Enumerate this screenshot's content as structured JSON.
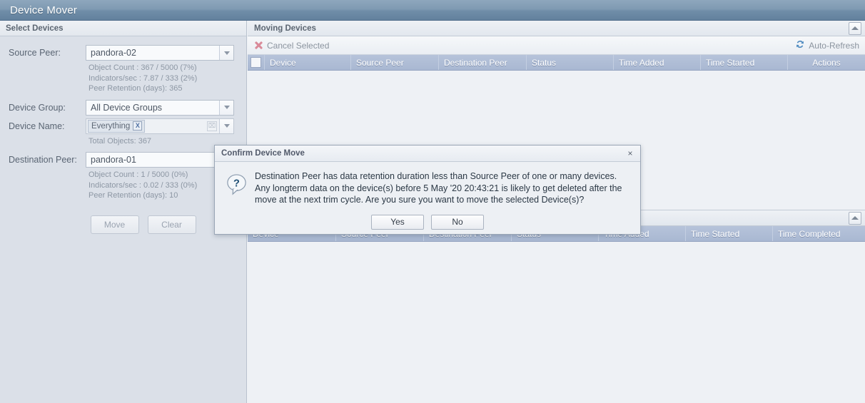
{
  "app": {
    "title": "Device Mover"
  },
  "left_panel": {
    "header": "Select Devices",
    "source_peer": {
      "label": "Source Peer:",
      "value": "pandora-02",
      "meta": [
        "Object Count : 367 / 5000 (7%)",
        "Indicators/sec : 7.87 / 333 (2%)",
        "Peer Retention (days): 365"
      ]
    },
    "device_group": {
      "label": "Device Group:",
      "value": "All Device Groups"
    },
    "device_name": {
      "label": "Device Name:",
      "tag": "Everything",
      "tag_remove": "X",
      "clear_all": "⌧",
      "meta": [
        "Total Objects: 367"
      ]
    },
    "destination_peer": {
      "label": "Destination Peer:",
      "value": "pandora-01",
      "meta": [
        "Object Count : 1 / 5000 (0%)",
        "Indicators/sec : 0.02 / 333 (0%)",
        "Peer Retention (days): 10"
      ]
    },
    "buttons": {
      "move": "Move",
      "clear": "Clear"
    }
  },
  "moving_panel": {
    "header": "Moving Devices",
    "toolbar": {
      "cancel_selected": "Cancel Selected",
      "auto_refresh": "Auto-Refresh"
    },
    "columns": [
      "Device",
      "Source Peer",
      "Destination Peer",
      "Status",
      "Time Added",
      "Time Started",
      "Actions"
    ],
    "rows": []
  },
  "completed_panel": {
    "columns": [
      "Device",
      "Source Peer",
      "Destination Peer",
      "Status",
      "Time Added",
      "Time Started",
      "Time Completed"
    ],
    "rows": []
  },
  "dialog": {
    "title": "Confirm Device Move",
    "close": "×",
    "icon": "question-bubble-icon",
    "message": "Destination Peer has data retention duration less than Source Peer of one or many devices. Any longterm data on the device(s) before 5 May '20 20:43:21 is likely to get deleted after the move at the next trim cycle. Are you sure you want to move the selected Device(s)?",
    "yes": "Yes",
    "no": "No"
  },
  "colors": {
    "titlebar_blue": "#6f8da8",
    "grid_header_blue": "#aebcd5",
    "cancel_icon_red": "#d98a99",
    "refresh_icon_blue": "#4f8bc0",
    "panel_bg": "#eef1f5",
    "left_panel_bg": "#dbe0e8"
  }
}
